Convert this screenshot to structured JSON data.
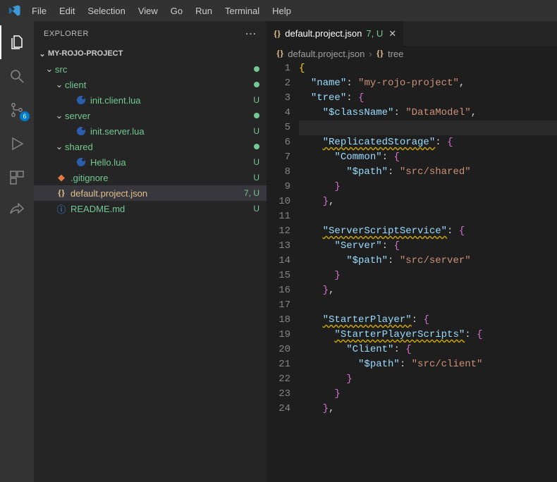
{
  "menu": [
    "File",
    "Edit",
    "Selection",
    "View",
    "Go",
    "Run",
    "Terminal",
    "Help"
  ],
  "sidebar": {
    "title": "EXPLORER",
    "project": "MY-ROJO-PROJECT",
    "scm_badge": "6"
  },
  "tree": {
    "src": {
      "label": "src"
    },
    "client": {
      "label": "client"
    },
    "initc": {
      "label": "init.client.lua",
      "status": "U"
    },
    "server": {
      "label": "server"
    },
    "inits": {
      "label": "init.server.lua",
      "status": "U"
    },
    "shared": {
      "label": "shared"
    },
    "hello": {
      "label": "Hello.lua",
      "status": "U"
    },
    "gitignore": {
      "label": ".gitignore",
      "status": "U"
    },
    "project": {
      "label": "default.project.json",
      "status": "7, U"
    },
    "readme": {
      "label": "README.md",
      "status": "U"
    }
  },
  "tab": {
    "label": "default.project.json",
    "status": "7, U"
  },
  "breadcrumb": {
    "file": "default.project.json",
    "node": "tree"
  },
  "code": [
    {
      "n": 1,
      "t": "{",
      "cls": "b1"
    },
    {
      "n": 2,
      "t": "  \"name\": \"my-rojo-project\",",
      "key": "name",
      "val": "my-rojo-project"
    },
    {
      "n": 3,
      "t": "  \"tree\": {",
      "key": "tree"
    },
    {
      "n": 4,
      "t": "    \"$className\": \"DataModel\",",
      "key": "$className",
      "val": "DataModel"
    },
    {
      "n": 5,
      "t": "",
      "hl": true
    },
    {
      "n": 6,
      "t": "    \"ReplicatedStorage\": {",
      "key": "ReplicatedStorage",
      "wavy": true
    },
    {
      "n": 7,
      "t": "      \"Common\": {",
      "key": "Common"
    },
    {
      "n": 8,
      "t": "        \"$path\": \"src/shared\"",
      "key": "$path",
      "val": "src/shared"
    },
    {
      "n": 9,
      "t": "      }"
    },
    {
      "n": 10,
      "t": "    },"
    },
    {
      "n": 11,
      "t": ""
    },
    {
      "n": 12,
      "t": "    \"ServerScriptService\": {",
      "key": "ServerScriptService",
      "wavy": true
    },
    {
      "n": 13,
      "t": "      \"Server\": {",
      "key": "Server"
    },
    {
      "n": 14,
      "t": "        \"$path\": \"src/server\"",
      "key": "$path",
      "val": "src/server"
    },
    {
      "n": 15,
      "t": "      }"
    },
    {
      "n": 16,
      "t": "    },"
    },
    {
      "n": 17,
      "t": ""
    },
    {
      "n": 18,
      "t": "    \"StarterPlayer\": {",
      "key": "StarterPlayer",
      "wavy": true
    },
    {
      "n": 19,
      "t": "      \"StarterPlayerScripts\": {",
      "key": "StarterPlayerScripts",
      "wavy": true
    },
    {
      "n": 20,
      "t": "        \"Client\": {",
      "key": "Client"
    },
    {
      "n": 21,
      "t": "          \"$path\": \"src/client\"",
      "key": "$path",
      "val": "src/client"
    },
    {
      "n": 22,
      "t": "        }"
    },
    {
      "n": 23,
      "t": "      }"
    },
    {
      "n": 24,
      "t": "    },"
    }
  ],
  "icons": {
    "braces": "{}",
    "chev_down": "⌄",
    "chev_right": "›"
  }
}
